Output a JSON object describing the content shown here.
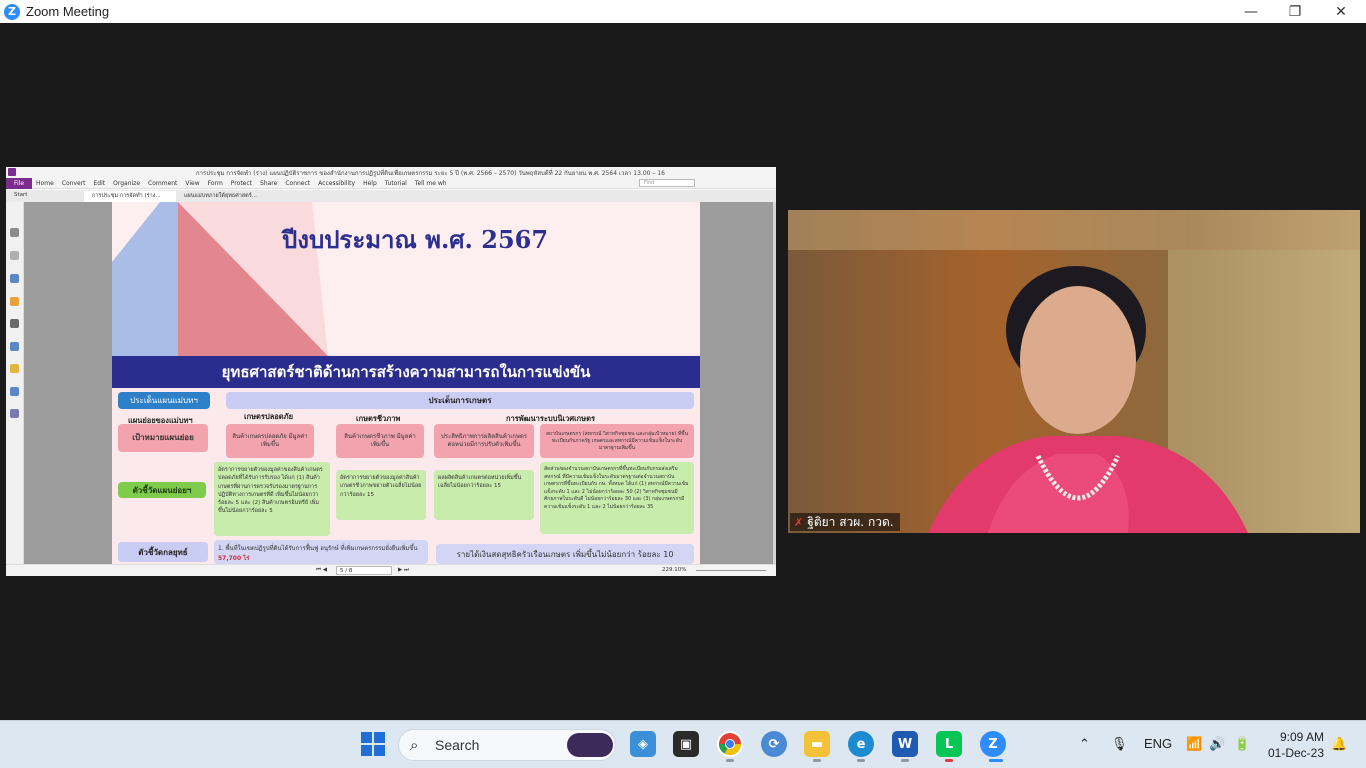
{
  "window": {
    "title": "Zoom Meeting",
    "logo_letter": "Z",
    "minimize": "—",
    "maximize": "❐",
    "close": "✕"
  },
  "pdf_app": {
    "doc_title": "การประชุม การจัดทำ (ร่าง) แผนปฏิบัติราชการ ของสำนักงานการปฏิรูปที่ดินเพื่อเกษตรกรรม ระยะ 5 ปี (พ.ศ. 2566 – 2570) วันพฤหัสบดีที่ 22 กันยายน พ.ศ. 2564 เวลา 13.00 – 16",
    "menu": [
      "File",
      "Home",
      "Convert",
      "Edit",
      "Organize",
      "Comment",
      "View",
      "Form",
      "Protect",
      "Share",
      "Connect",
      "Accessibility",
      "Help",
      "Tutorial",
      "Tell me wh"
    ],
    "search_placeholder": "Find",
    "tabs": [
      "Start",
      "การประชุม การจัดทำ (ร่าง...",
      "แผนแม่บทภายใต้ยุทธศาสตร์..."
    ],
    "page_indicator": "5 / 8",
    "zoom": "229.10%"
  },
  "slide": {
    "year_title": "ปีงบประมาณ พ.ศ. 2567",
    "banner": "ยุทธศาสตร์ชาติด้านการสร้างความสามารถในการแข่งขัน",
    "plan_issue_label": "ประเด็นแผนแม่บทฯ",
    "agri_issue_label": "ประเด็นการเกษตร",
    "sub_plan_label": "แผนย่อยของแม่บทฯ",
    "col_safe": "เกษตรปลอดภัย",
    "col_bio": "เกษตรชีวภาพ",
    "col_smart": "การพัฒนาระบบนิเวศเกษตร",
    "target_label": "เป้าหมายแผนย่อย",
    "target_safe": "สินค้าเกษตรปลอดภัย มีมูลค่าเพิ่มขึ้น",
    "target_bio": "สินค้าเกษตรชีวภาพ มีมูลค่าเพิ่มขึ้น",
    "target_process": "ประสิทธิภาพการผลิตสินค้าเกษตร ต่อหน่วยมีการปรับตัวเพิ่มขึ้น",
    "target_inst": "สถาบันเกษตรกร (สหกรณ์ วิสาหกิจชุมชน และกลุ่มเป้าหมาย) ที่ขึ้นทะเบียนกับภาครัฐ เกษตรและสหกรณ์มีความเข้มแข็งในระดับมาตรฐานเพิ่มขึ้น",
    "indicator_label": "ตัวชี้วัดแผนย่อยฯ",
    "ind_safe": "อัตราการขยายตัวของมูลค่าของสินค้าเกษตรปลอดภัยที่ได้รับการรับรอง ได้แก่ (1) สินค้าเกษตรที่ผ่านการตรวจรับรองมาตรฐานการปฏิบัติทางการเกษตรที่ดี เพิ่มขึ้นไม่น้อยกว่าร้อยละ 5 และ (2) สินค้าเกษตรอินทรีย์ เพิ่มขึ้นไม่น้อยกว่าร้อยละ 5",
    "ind_bio": "อัตราการขยายตัวของมูลค่าสินค้าเกษตรชีวภาพขยายตัวเฉลี่ยไม่น้อยกว่าร้อยละ 15",
    "ind_process": "ผลผลิตสินค้าเกษตรต่อหน่วยเพิ่มขึ้นเฉลี่ยไม่น้อยกว่าร้อยละ 15",
    "ind_inst": "สัดส่วนของจำนวนสถาบันเกษตรกรที่ขึ้นทะเบียนกับกรมส่งเสริมสหกรณ์ ที่มีความเข้มแข็งในระดับมาตรฐานต่อจำนวนสถาบันเกษตรกรที่ขึ้นทะเบียนกับ กษ. ทั้งหมด ได้แก่ (1) สหกรณ์มีความเข้มแข็งระดับ 1 และ 2 ไม่น้อยกว่าร้อยละ 50 (2) วิสาหกิจชุมชนมีศักยภาพในระดับดี ไม่น้อยกว่าร้อยละ 30 และ (3) กลุ่มเกษตรกรมีความเข้มแข็งระดับ 1 และ 2 ไม่น้อยกว่าร้อยละ 35",
    "strategic_label": "ตัวชี้วัดกลยุทธ์",
    "strategic_text": "1. พื้นที่ในเขตปฏิรูปที่ดินได้รับการฟื้นฟู อนุรักษ์ ที่เพิ่มเกษตรกรรมยั่งยืนเพิ่มขึ้น",
    "strategic_value": "57,700 ไร่",
    "income_text": "รายได้เงินสดสุทธิครัวเรือนเกษตร เพิ่มขึ้นไม่น้อยกว่า ร้อยละ 10"
  },
  "participant": {
    "name": "ฐิติยา สวผ. กวด."
  },
  "taskbar": {
    "search_label": "Search",
    "language": "ENG",
    "time": "9:09 AM",
    "date": "01-Dec-23"
  },
  "colors": {
    "slide_navy": "#2a2c8e",
    "zoom_blue": "#2d8cff",
    "line_green": "#06c755"
  }
}
